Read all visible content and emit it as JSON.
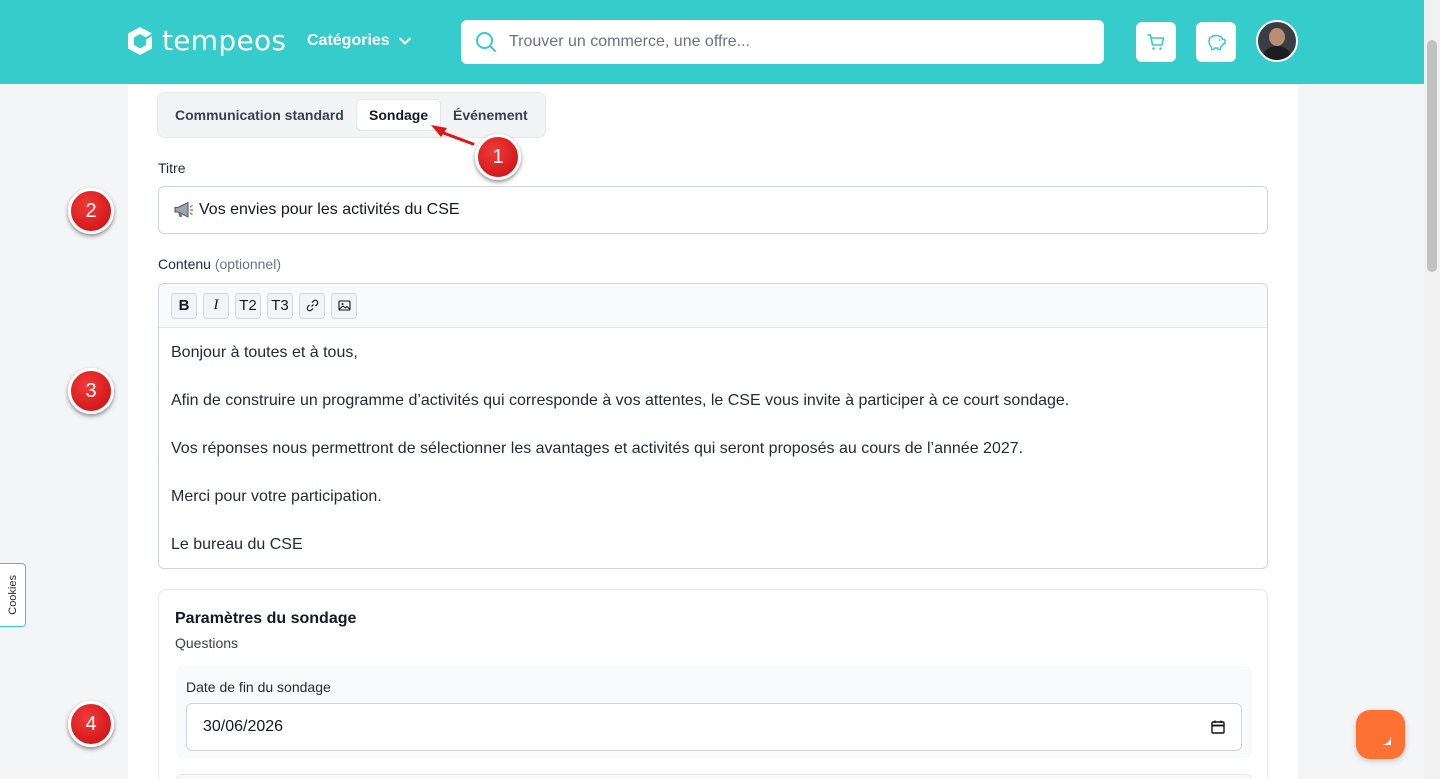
{
  "header": {
    "logo_text": "tempeos",
    "categories_label": "Catégories",
    "search_placeholder": "Trouver un commerce, une offre...",
    "brand_color": "#35cccb"
  },
  "tabs": [
    {
      "label": "Communication standard",
      "active": false
    },
    {
      "label": "Sondage",
      "active": true
    },
    {
      "label": "Événement",
      "active": false
    }
  ],
  "form": {
    "title_label": "Titre",
    "title_value": "Vos envies pour les activités du CSE",
    "title_icon": "megaphone-icon",
    "content_label": "Contenu",
    "content_optional": "(optionnel)",
    "toolbar": [
      "B",
      "I",
      "T2",
      "T3",
      "link-icon",
      "image-icon"
    ],
    "content_paragraphs": [
      "Bonjour à toutes et à tous,",
      "Afin de construire un programme d’activités qui corresponde à vos attentes, le CSE vous invite à participer à ce court sondage.",
      "Vos réponses nous permettront de sélectionner les avantages et activités qui seront proposés au cours de l’année 2027.",
      "Merci pour votre participation.",
      "Le bureau du CSE"
    ]
  },
  "settings": {
    "title": "Paramètres du sondage",
    "subtitle": "Questions",
    "end_date_label": "Date de fin du sondage",
    "end_date_value": "30/06/2026"
  },
  "markers": [
    "1",
    "2",
    "3",
    "4"
  ],
  "cookies_label": "Cookies"
}
